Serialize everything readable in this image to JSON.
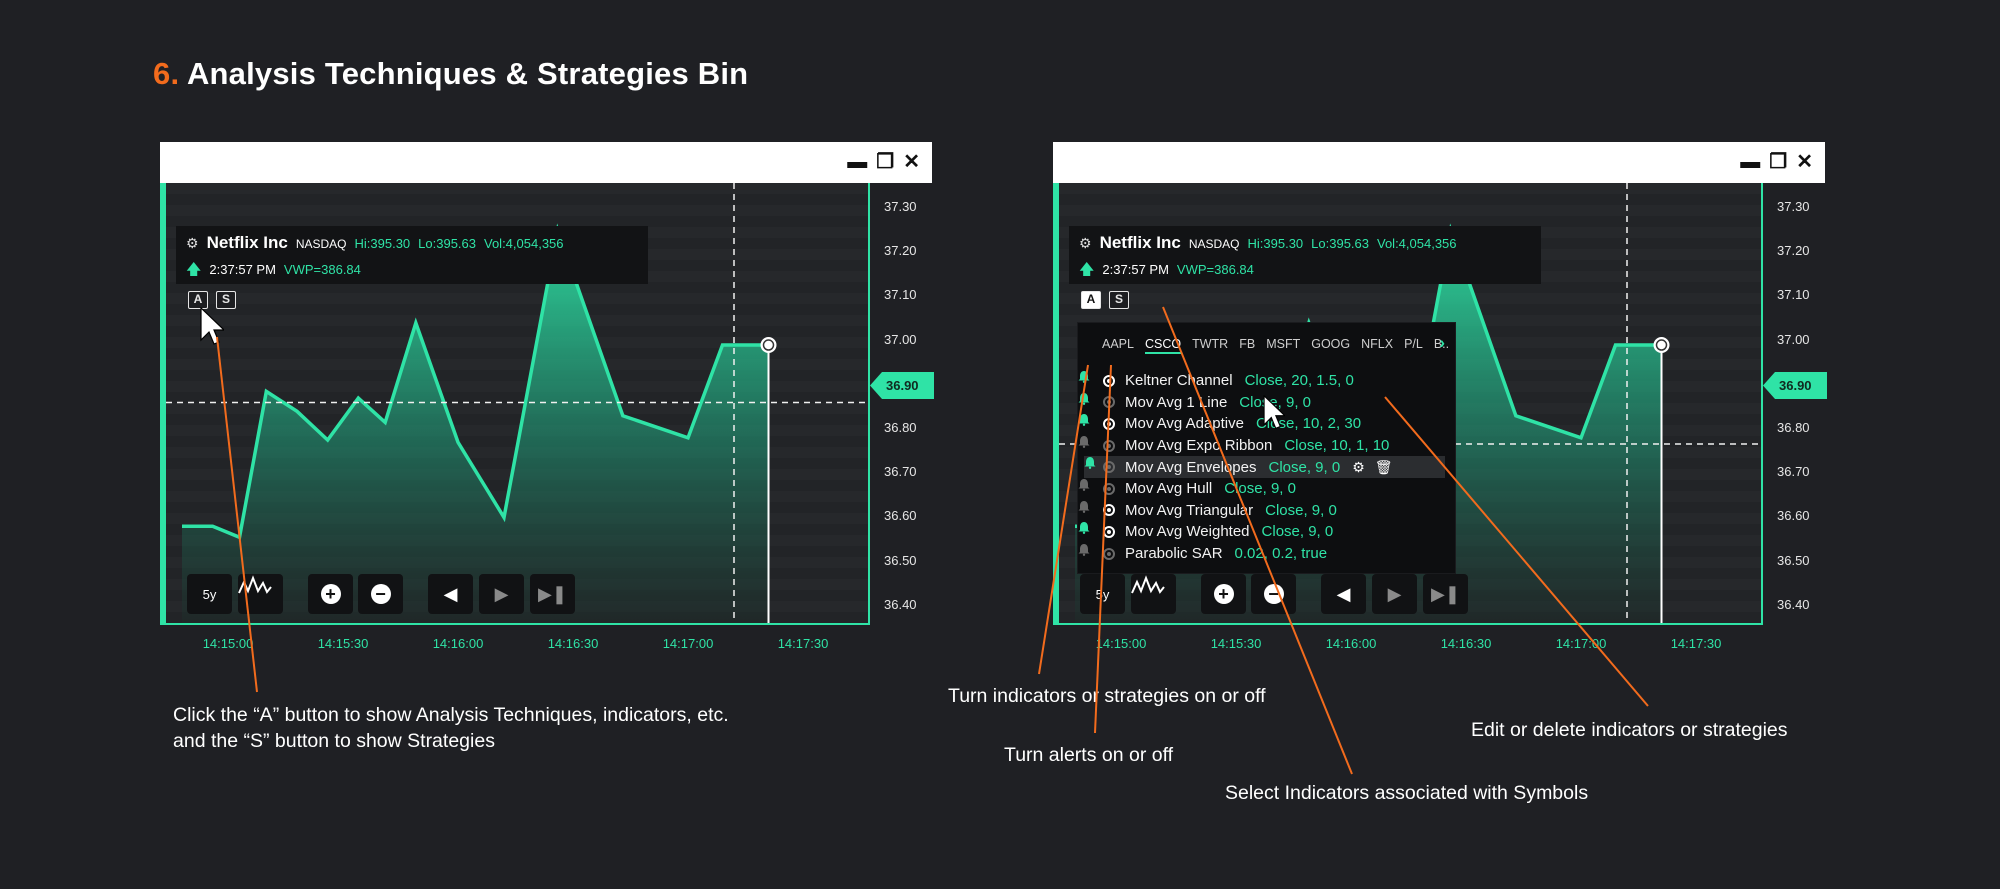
{
  "heading": {
    "number": "6.",
    "title": "Analysis Techniques & Strategies Bin"
  },
  "colors": {
    "accent": "#2fe3a6",
    "callout": "#f26b1d",
    "background": "#1f2024"
  },
  "symbol": {
    "name": "Netflix Inc",
    "exchange": "NASDAQ",
    "hi": "Hi:395.30",
    "lo": "Lo:395.63",
    "vol": "Vol:4,054,356",
    "time": "2:37:57 PM",
    "vwp": "VWP=386.84",
    "icon": "settings-gear-icon",
    "trend_icon": "arrow-up-icon"
  },
  "buttons": {
    "analysis": "A",
    "strategies": "S"
  },
  "toolbar": {
    "range": "5y",
    "chart_type_icon": "line-chart-icon",
    "zoom_in_icon": "plus-circle-icon",
    "zoom_out_icon": "minus-circle-icon",
    "back_icon": "triangle-left-icon",
    "forward_icon": "triangle-right-icon",
    "end_icon": "skip-end-icon"
  },
  "window_controls": [
    "minimize-icon",
    "restore-icon",
    "close-icon"
  ],
  "y_ticks": [
    "37.30",
    "37.20",
    "37.10",
    "37.00",
    "36.90",
    "36.80",
    "36.70",
    "36.60",
    "36.50",
    "36.40"
  ],
  "current_price": "36.90",
  "x_ticks": [
    "14:15:00",
    "14:15:30",
    "14:16:00",
    "14:16:30",
    "14:17:00",
    "14:17:30"
  ],
  "chart_data": {
    "type": "area",
    "x": [
      "14:14:48",
      "14:14:56",
      "14:15:03",
      "14:15:10",
      "14:15:18",
      "14:15:26",
      "14:15:34",
      "14:15:41",
      "14:15:49",
      "14:16:00",
      "14:16:12",
      "14:16:26",
      "14:16:43",
      "14:17:00",
      "14:17:09",
      "14:17:21"
    ],
    "values": [
      36.58,
      36.58,
      36.555,
      36.885,
      36.84,
      36.775,
      36.87,
      36.815,
      37.04,
      36.77,
      36.6,
      37.25,
      36.83,
      36.78,
      36.99,
      36.99
    ],
    "ylim": [
      36.35,
      37.35
    ],
    "grid": true,
    "crosshair": {
      "time": "14:17:12",
      "price": 36.86
    },
    "marker": {
      "time": "14:17:21",
      "price": 36.99
    }
  },
  "indicator_tabs": [
    "AAPL",
    "CSCO",
    "TWTR",
    "FB",
    "MSFT",
    "GOOG",
    "NFLX",
    "P/L",
    "B.."
  ],
  "active_tab": "CSCO",
  "more_icon": "chevron-right-icon",
  "indicators": [
    {
      "name": "Keltner Channel",
      "params": "Close, 20, 1.5, 0",
      "enabled": true,
      "alert": true
    },
    {
      "name": "Mov Avg 1 Line",
      "params": "Close, 9, 0",
      "enabled": false,
      "alert": true
    },
    {
      "name": "Mov Avg Adaptive",
      "params": "Close, 10, 2, 30",
      "enabled": true,
      "alert": true
    },
    {
      "name": "Mov Avg Expo Ribbon",
      "params": "Close, 10, 1, 10",
      "enabled": false,
      "alert": false
    },
    {
      "name": "Mov Avg Envelopes",
      "params": "Close, 9, 0",
      "enabled": false,
      "alert": true,
      "edit_icon": "gear-icon",
      "delete_icon": "trash-icon"
    },
    {
      "name": "Mov Avg Hull",
      "params": "Close, 9, 0",
      "enabled": false,
      "alert": false
    },
    {
      "name": "Mov Avg Triangular",
      "params": "Close, 9, 0",
      "enabled": true,
      "alert": false
    },
    {
      "name": "Mov Avg Weighted",
      "params": "Close, 9, 0",
      "enabled": true,
      "alert": true
    },
    {
      "name": "Parabolic SAR",
      "params": "0.02, 0.2, true",
      "enabled": false,
      "alert": false
    }
  ],
  "captions": {
    "left_line1": "Click the “A” button to show Analysis Techniques, indicators, etc.",
    "left_line2": "and the “S” button to show Strategies",
    "toggle": "Turn indicators or strategies on or off",
    "alerts": "Turn alerts on or off",
    "select": "Select Indicators associated with Symbols",
    "edit": "Edit or delete indicators or strategies"
  }
}
